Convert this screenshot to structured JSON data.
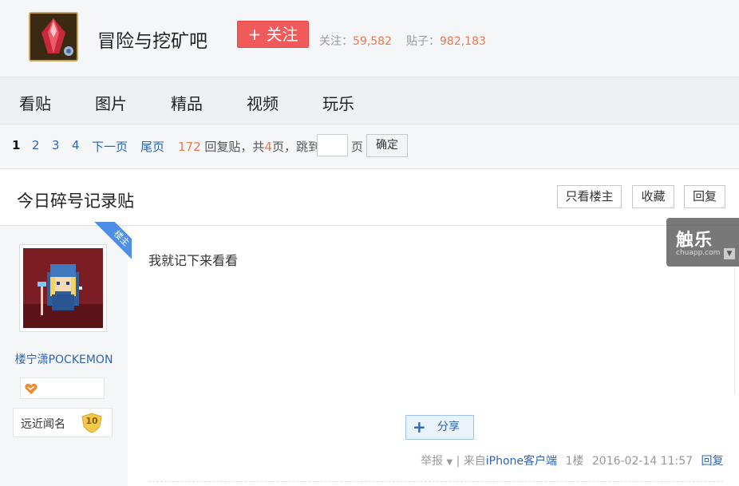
{
  "header": {
    "forum_name": "冒险与挖矿吧",
    "follow_label": "+ 关注",
    "followers_label": "关注：",
    "followers_count": "59,582",
    "posts_label": "贴子：",
    "posts_count": "982,183",
    "forum_icon": "red-crystal-icon"
  },
  "nav": {
    "items": [
      "看贴",
      "图片",
      "精品",
      "视频",
      "玩乐"
    ]
  },
  "pager": {
    "pages": [
      "1",
      "2",
      "3",
      "4"
    ],
    "current": "1",
    "next_label": "下一页",
    "last_label": "尾页",
    "reply_count": "172",
    "reply_label": " 回复贴，共",
    "total_pages": "4",
    "pages_suffix": "页，跳到",
    "page_unit": "页",
    "confirm_label": "确定"
  },
  "thread": {
    "title": "今日碎号记录贴",
    "only_op_label": "只看楼主",
    "favorite_label": "收藏",
    "reply_label": "回复"
  },
  "author": {
    "op_badge": "楼主",
    "username": "楼宁潇POCKEMON",
    "level_name": "远近闻名",
    "level": "10"
  },
  "post": {
    "content": "我就记下来看看",
    "share_label": "分享",
    "report_label": "举报",
    "separator": " | 来自",
    "source": "iPhone客户端",
    "floor": "1楼",
    "timestamp": "2016-02-14 11:57",
    "reply_label": "回复"
  },
  "watermark": {
    "title": "触乐",
    "domain": "chuapp.com"
  },
  "colors": {
    "accent_red": "#f05a5a",
    "link_blue": "#2d64b3",
    "number_orange": "#e9794f"
  }
}
